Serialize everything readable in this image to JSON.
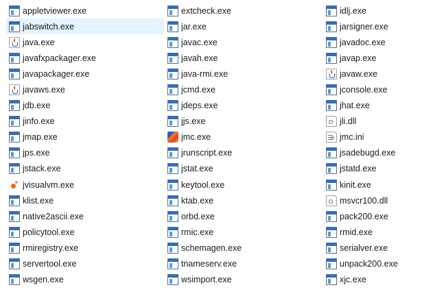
{
  "files": [
    [
      {
        "name": "appletviewer.exe",
        "icon": "exe-icon"
      },
      {
        "name": "jabswitch.exe",
        "icon": "exe-icon",
        "selected": true
      },
      {
        "name": "java.exe",
        "icon": "java-icon"
      },
      {
        "name": "javafxpackager.exe",
        "icon": "exe-icon"
      },
      {
        "name": "javapackager.exe",
        "icon": "exe-icon"
      },
      {
        "name": "javaws.exe",
        "icon": "java-icon"
      },
      {
        "name": "jdb.exe",
        "icon": "exe-icon"
      },
      {
        "name": "jinfo.exe",
        "icon": "exe-icon"
      },
      {
        "name": "jmap.exe",
        "icon": "exe-icon"
      },
      {
        "name": "jps.exe",
        "icon": "exe-icon"
      },
      {
        "name": "jstack.exe",
        "icon": "exe-icon"
      },
      {
        "name": "jvisualvm.exe",
        "icon": "visualvm-icon"
      },
      {
        "name": "klist.exe",
        "icon": "exe-icon"
      },
      {
        "name": "native2ascii.exe",
        "icon": "exe-icon"
      },
      {
        "name": "policytool.exe",
        "icon": "exe-icon"
      },
      {
        "name": "rmiregistry.exe",
        "icon": "exe-icon"
      },
      {
        "name": "servertool.exe",
        "icon": "exe-icon"
      },
      {
        "name": "wsgen.exe",
        "icon": "exe-icon"
      }
    ],
    [
      {
        "name": "extcheck.exe",
        "icon": "exe-icon"
      },
      {
        "name": "jar.exe",
        "icon": "exe-icon"
      },
      {
        "name": "javac.exe",
        "icon": "exe-icon"
      },
      {
        "name": "javah.exe",
        "icon": "exe-icon"
      },
      {
        "name": "java-rmi.exe",
        "icon": "exe-icon"
      },
      {
        "name": "jcmd.exe",
        "icon": "exe-icon"
      },
      {
        "name": "jdeps.exe",
        "icon": "exe-icon"
      },
      {
        "name": "jjs.exe",
        "icon": "exe-icon"
      },
      {
        "name": "jmc.exe",
        "icon": "jmc-icon"
      },
      {
        "name": "jrunscript.exe",
        "icon": "exe-icon"
      },
      {
        "name": "jstat.exe",
        "icon": "exe-icon"
      },
      {
        "name": "keytool.exe",
        "icon": "exe-icon"
      },
      {
        "name": "ktab.exe",
        "icon": "exe-icon"
      },
      {
        "name": "orbd.exe",
        "icon": "exe-icon"
      },
      {
        "name": "rmic.exe",
        "icon": "exe-icon"
      },
      {
        "name": "schemagen.exe",
        "icon": "exe-icon"
      },
      {
        "name": "tnameserv.exe",
        "icon": "exe-icon"
      },
      {
        "name": "wsimport.exe",
        "icon": "exe-icon"
      }
    ],
    [
      {
        "name": "idlj.exe",
        "icon": "exe-icon"
      },
      {
        "name": "jarsigner.exe",
        "icon": "exe-icon"
      },
      {
        "name": "javadoc.exe",
        "icon": "exe-icon"
      },
      {
        "name": "javap.exe",
        "icon": "exe-icon"
      },
      {
        "name": "javaw.exe",
        "icon": "java-icon"
      },
      {
        "name": "jconsole.exe",
        "icon": "exe-icon"
      },
      {
        "name": "jhat.exe",
        "icon": "exe-icon"
      },
      {
        "name": "jli.dll",
        "icon": "dll-icon"
      },
      {
        "name": "jmc.ini",
        "icon": "ini-icon"
      },
      {
        "name": "jsadebugd.exe",
        "icon": "exe-icon"
      },
      {
        "name": "jstatd.exe",
        "icon": "exe-icon"
      },
      {
        "name": "kinit.exe",
        "icon": "exe-icon"
      },
      {
        "name": "msvcr100.dll",
        "icon": "dll-icon"
      },
      {
        "name": "pack200.exe",
        "icon": "exe-icon"
      },
      {
        "name": "rmid.exe",
        "icon": "exe-icon"
      },
      {
        "name": "serialver.exe",
        "icon": "exe-icon"
      },
      {
        "name": "unpack200.exe",
        "icon": "exe-icon"
      },
      {
        "name": "xjc.exe",
        "icon": "exe-icon"
      }
    ]
  ],
  "colors": {
    "selection": "#e5f3ff",
    "exe_bar": "#2f6fbf"
  }
}
